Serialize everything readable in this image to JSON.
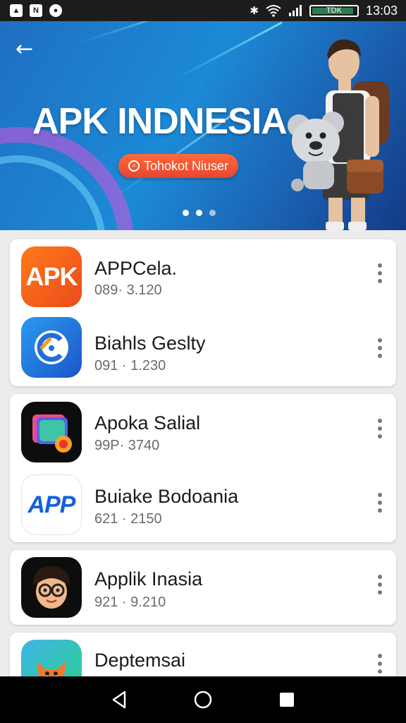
{
  "status_bar": {
    "left_icons": [
      "notification-app-icon",
      "notification-app-icon",
      "notification-app-icon"
    ],
    "battery": "TDK",
    "time": "13:03"
  },
  "hero": {
    "title": "APK INDNESIA",
    "button_label": "Tohokot Niuser",
    "carousel_pages": 3,
    "carousel_active": 1
  },
  "apps": [
    {
      "name": "APPCela.",
      "meta": "089· 3.120",
      "icon": "apk-icon",
      "color": "#f05a1c"
    },
    {
      "name": "Biahls Geslty",
      "meta": "091 · 1.230",
      "icon": "c-logo-icon",
      "color": "#1f8ae0"
    },
    {
      "name": "Apoka Salial",
      "meta": "99P· 3740",
      "icon": "layered-cards-icon",
      "color": "#111111"
    },
    {
      "name": "Buiake Bodoania",
      "meta": "621 · 2150",
      "icon": "app-text-icon",
      "color": "#1560d8"
    },
    {
      "name": "Applik Inasia",
      "meta": "921 · 9.210",
      "icon": "avatar-face-icon",
      "color": "#111111"
    },
    {
      "name": "Deptemsai",
      "meta": "",
      "icon": "fox-icon",
      "color": "#3aa0d8"
    }
  ],
  "icon_labels": {
    "apk": "APK",
    "app": "APP"
  }
}
